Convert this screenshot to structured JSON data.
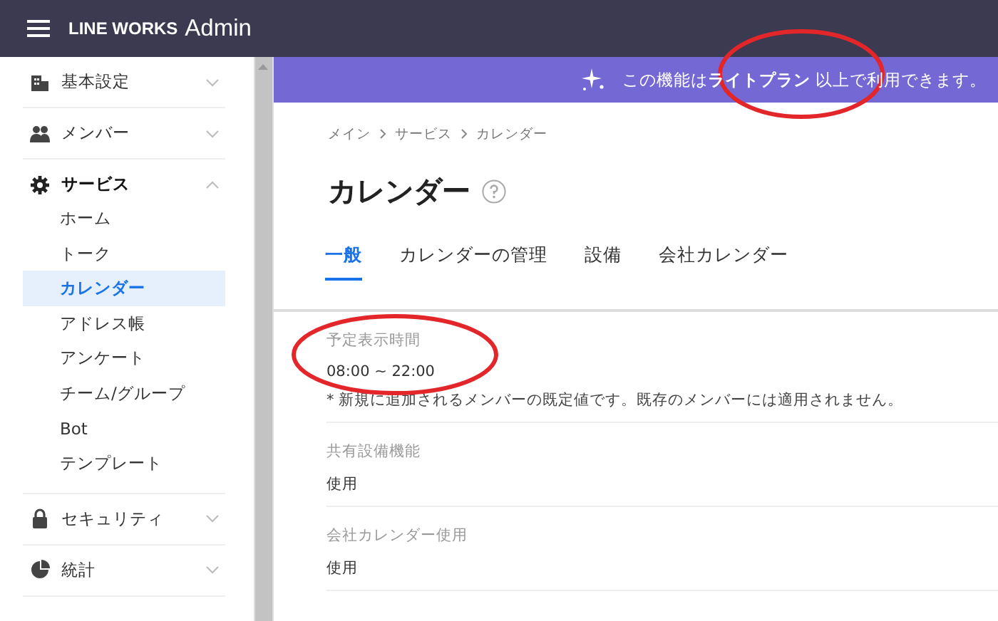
{
  "header": {
    "brand": "LINE WORKS",
    "product": "Admin"
  },
  "sidebar": {
    "items": [
      {
        "label": "基本設定",
        "expanded": false
      },
      {
        "label": "メンバー",
        "expanded": false
      },
      {
        "label": "サービス",
        "expanded": true,
        "children": [
          {
            "label": "ホーム",
            "selected": false
          },
          {
            "label": "トーク",
            "selected": false
          },
          {
            "label": "カレンダー",
            "selected": true
          },
          {
            "label": "アドレス帳",
            "selected": false
          },
          {
            "label": "アンケート",
            "selected": false
          },
          {
            "label": "チーム/グループ",
            "selected": false
          },
          {
            "label": "Bot",
            "selected": false
          },
          {
            "label": "テンプレート",
            "selected": false
          }
        ]
      },
      {
        "label": "セキュリティ",
        "expanded": false
      },
      {
        "label": "統計",
        "expanded": false
      }
    ]
  },
  "banner": {
    "text": "この機能は**ライトプラン** 以上で利用できます。"
  },
  "breadcrumb": [
    "メイン",
    "サービス",
    "カレンダー"
  ],
  "title": "カレンダー",
  "tabs": [
    {
      "label": "一般",
      "selected": true
    },
    {
      "label": "カレンダーの管理",
      "selected": false
    },
    {
      "label": "設備",
      "selected": false
    },
    {
      "label": "会社カレンダー",
      "selected": false
    }
  ],
  "settings": [
    {
      "label": "予定表示時間",
      "value": "08:00 ~ 22:00",
      "note": "* 新規に追加されるメンバーの既定値です。既存のメンバーには適用されません。"
    },
    {
      "label": "共有設備機能",
      "value": "使用"
    },
    {
      "label": "会社カレンダー使用",
      "value": "使用"
    }
  ],
  "annotations": [
    {
      "kind": "ellipse",
      "color": "#e3262a"
    },
    {
      "kind": "ellipse",
      "color": "#e3262a"
    }
  ]
}
